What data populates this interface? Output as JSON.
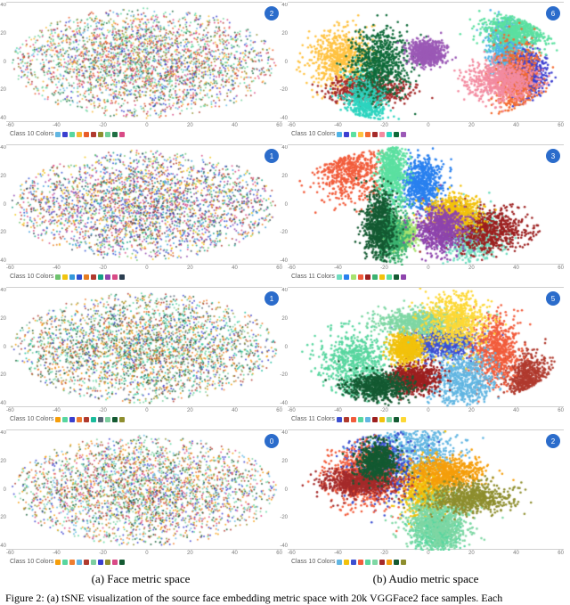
{
  "panels": [
    {
      "side": "a",
      "row": 0,
      "style": "scatter",
      "mix": "high",
      "palette": "p10",
      "badge": "2",
      "legend_label": "Class 10 Colors",
      "x_ticks": [
        "-60",
        "-40",
        "-20",
        "0",
        "20",
        "40",
        "60"
      ],
      "y_ticks": [
        "40",
        "20",
        "0",
        "-20",
        "-40"
      ]
    },
    {
      "side": "b",
      "row": 0,
      "style": "blob",
      "mix": "low",
      "palette": "p10b",
      "badge": "6",
      "legend_label": "Class 10 Colors",
      "x_ticks": [
        "-60",
        "-40",
        "-20",
        "0",
        "20",
        "40",
        "60"
      ],
      "y_ticks": [
        "40",
        "20",
        "0",
        "-20",
        "-40"
      ]
    },
    {
      "side": "a",
      "row": 1,
      "style": "scatter",
      "mix": "high",
      "palette": "p11",
      "badge": "1",
      "legend_label": "Class 10 Colors",
      "x_ticks": [
        "-60",
        "-40",
        "-20",
        "0",
        "20",
        "40",
        "60"
      ],
      "y_ticks": [
        "40",
        "20",
        "0",
        "-20",
        "-40"
      ]
    },
    {
      "side": "b",
      "row": 1,
      "style": "blob",
      "mix": "low",
      "palette": "p11b",
      "badge": "3",
      "legend_label": "Class 11 Colors",
      "x_ticks": [
        "-60",
        "-40",
        "-20",
        "0",
        "20",
        "40",
        "60"
      ],
      "y_ticks": [
        "40",
        "20",
        "0",
        "-20",
        "-40"
      ]
    },
    {
      "side": "a",
      "row": 2,
      "style": "scatter",
      "mix": "high",
      "palette": "p12",
      "badge": "1",
      "legend_label": "Class 10 Colors",
      "x_ticks": [
        "-60",
        "-40",
        "-20",
        "0",
        "20",
        "40",
        "60"
      ],
      "y_ticks": [
        "40",
        "20",
        "0",
        "-20",
        "-40"
      ]
    },
    {
      "side": "b",
      "row": 2,
      "style": "blob",
      "mix": "low",
      "palette": "p12b",
      "badge": "5",
      "legend_label": "Class 11 Colors",
      "x_ticks": [
        "-60",
        "-40",
        "-20",
        "0",
        "20",
        "40",
        "60"
      ],
      "y_ticks": [
        "40",
        "20",
        "0",
        "-20",
        "-40"
      ]
    },
    {
      "side": "a",
      "row": 3,
      "style": "scatter",
      "mix": "high",
      "palette": "p13",
      "badge": "0",
      "legend_label": "Class 10 Colors",
      "x_ticks": [
        "-60",
        "-40",
        "-20",
        "0",
        "20",
        "40",
        "60"
      ],
      "y_ticks": [
        "40",
        "20",
        "0",
        "-20",
        "-40"
      ]
    },
    {
      "side": "b",
      "row": 3,
      "style": "blob",
      "mix": "low",
      "palette": "p13b",
      "badge": "2",
      "legend_label": "Class 10 Colors",
      "x_ticks": [
        "-60",
        "-40",
        "-20",
        "0",
        "20",
        "40",
        "60"
      ],
      "y_ticks": [
        "40",
        "20",
        "0",
        "-20",
        "-40"
      ]
    }
  ],
  "palettes": {
    "p10": [
      "#62b6e2",
      "#3a3fcf",
      "#58d69f",
      "#f7b733",
      "#e95d2a",
      "#b03a2e",
      "#8e8e2e",
      "#6fcf97",
      "#1f6f43",
      "#d94a86"
    ],
    "p10b": [
      "#4fb3e6",
      "#3c3fd1",
      "#5be0a0",
      "#ffc240",
      "#f46a2f",
      "#a52a2a",
      "#f38ba0",
      "#2dd4bf",
      "#0f6b3a",
      "#9b59b6"
    ],
    "p11": [
      "#6fc36f",
      "#f1c40f",
      "#3498db",
      "#2e4fd1",
      "#e67e22",
      "#b03a2e",
      "#16a085",
      "#8e44ad",
      "#d94a86",
      "#2c3e50"
    ],
    "p11b": [
      "#6fddc0",
      "#2980ef",
      "#a7e26f",
      "#f25c3b",
      "#9c1f1f",
      "#3cb371",
      "#f2c20c",
      "#5be0a0",
      "#145a32",
      "#8e44ad"
    ],
    "p12": [
      "#f59e0b",
      "#58d69f",
      "#3a3fcf",
      "#ef7d2f",
      "#b03a2e",
      "#1abc9c",
      "#566573",
      "#7dcea0",
      "#145a32",
      "#8e8e2e"
    ],
    "p12b": [
      "#3c4fd1",
      "#b03a2e",
      "#f25c3b",
      "#58d69f",
      "#62b6e2",
      "#9c1f1f",
      "#f2c20c",
      "#7fd7a4",
      "#145a32",
      "#fdd835"
    ],
    "p13": [
      "#f59e0b",
      "#58d69f",
      "#ef7d2f",
      "#62b6e2",
      "#b03a2e",
      "#7dcea0",
      "#3a3fcf",
      "#8e8e2e",
      "#d94a86",
      "#145a32"
    ],
    "p13b": [
      "#62b6e2",
      "#f2c20c",
      "#3c4fd1",
      "#f25c3b",
      "#58d69f",
      "#7fd7a4",
      "#a52a2a",
      "#f59e0b",
      "#145a32",
      "#8e8e2e"
    ]
  },
  "captions": {
    "a": "(a) Face metric space",
    "b": "(b) Audio metric space"
  },
  "figure_line": "Figure 2: (a) tSNE visualization of the source face embedding metric space with 20k VGGFace2 face samples. Each",
  "chart_data": {
    "type": "scatter",
    "note": "tSNE embeddings; exact point coordinates not readable from image. Each panel shows ~20k points in 10–11 color-coded classes spanning roughly x∈[-60,60], y∈[-40,40]. Left column (a) has highly intermixed classes; right column (b) shows well-separated clusters.",
    "panels": [
      {
        "id": "a-row0",
        "classes": 10,
        "separation": "low"
      },
      {
        "id": "b-row0",
        "classes": 10,
        "separation": "high"
      },
      {
        "id": "a-row1",
        "classes": 10,
        "separation": "low"
      },
      {
        "id": "b-row1",
        "classes": 11,
        "separation": "high"
      },
      {
        "id": "a-row2",
        "classes": 10,
        "separation": "low"
      },
      {
        "id": "b-row2",
        "classes": 11,
        "separation": "high"
      },
      {
        "id": "a-row3",
        "classes": 10,
        "separation": "low"
      },
      {
        "id": "b-row3",
        "classes": 10,
        "separation": "high"
      }
    ],
    "xlim": [
      -60,
      60
    ],
    "ylim": [
      -40,
      40
    ]
  }
}
